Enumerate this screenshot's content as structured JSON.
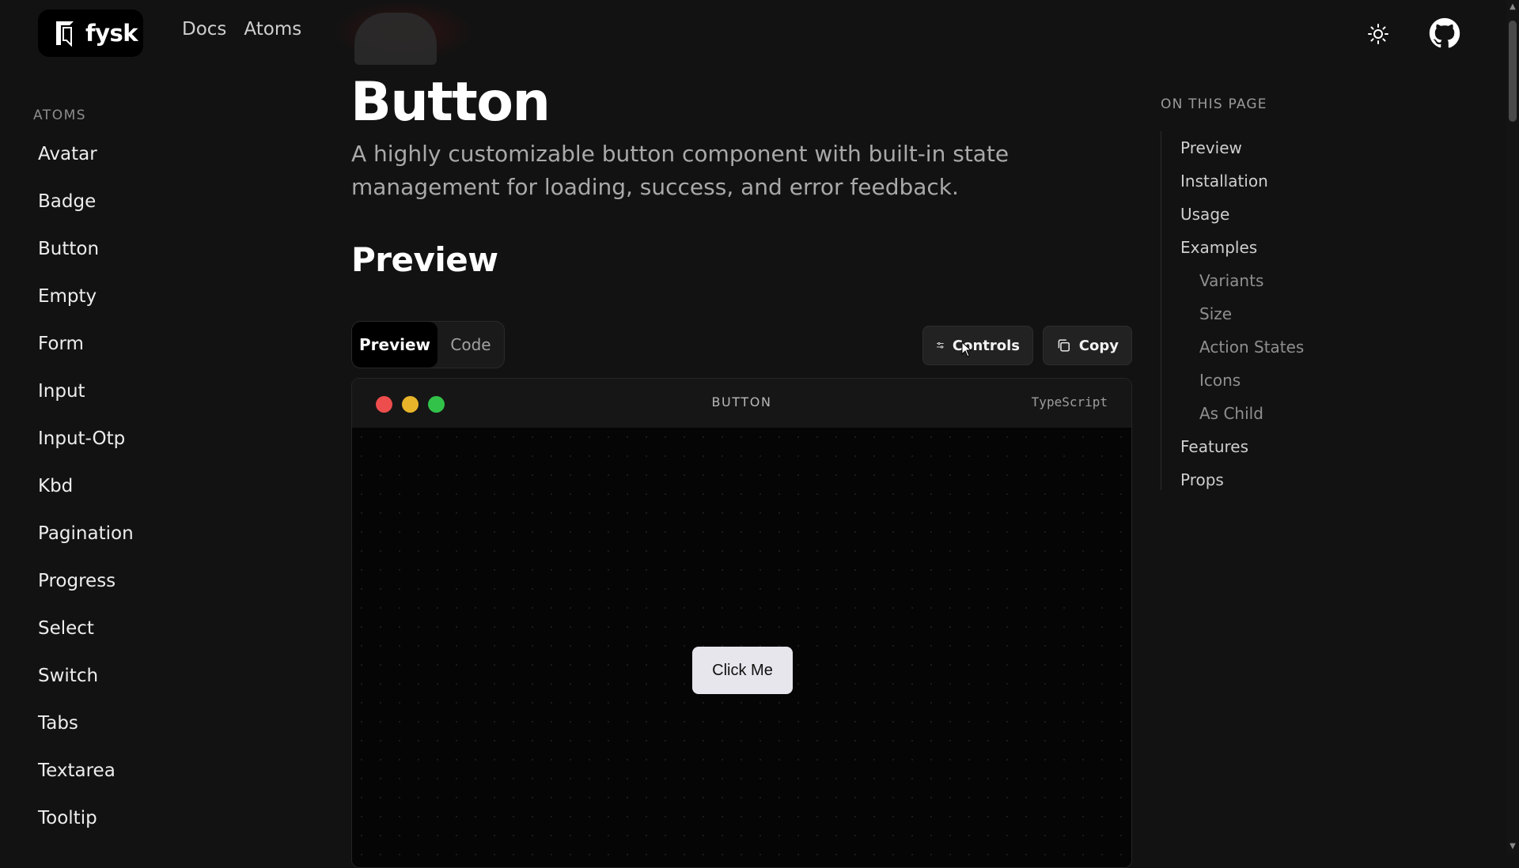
{
  "brand": {
    "name": "fysk"
  },
  "top_nav": {
    "docs": "Docs",
    "atoms": "Atoms"
  },
  "sidebar": {
    "heading": "ATOMS",
    "items": [
      "Avatar",
      "Badge",
      "Button",
      "Empty",
      "Form",
      "Input",
      "Input-Otp",
      "Kbd",
      "Pagination",
      "Progress",
      "Select",
      "Switch",
      "Tabs",
      "Textarea",
      "Tooltip"
    ]
  },
  "main": {
    "title": "Button",
    "description": "A highly customizable button component with built-in state management for loading, success, and error feedback.",
    "section_title": "Preview",
    "tabs": {
      "preview": "Preview",
      "code": "Code"
    },
    "controls_label": "Controls",
    "copy_label": "Copy",
    "frame": {
      "title": "BUTTON",
      "language": "TypeScript"
    },
    "demo_button": "Click Me"
  },
  "toc": {
    "heading": "ON THIS PAGE",
    "items": [
      {
        "label": "Preview",
        "level": 1
      },
      {
        "label": "Installation",
        "level": 1
      },
      {
        "label": "Usage",
        "level": 1
      },
      {
        "label": "Examples",
        "level": 1
      },
      {
        "label": "Variants",
        "level": 2
      },
      {
        "label": "Size",
        "level": 2
      },
      {
        "label": "Action States",
        "level": 2
      },
      {
        "label": "Icons",
        "level": 2
      },
      {
        "label": "As Child",
        "level": 2
      },
      {
        "label": "Features",
        "level": 1
      },
      {
        "label": "Props",
        "level": 1
      }
    ]
  },
  "icons": {
    "theme": "sun-icon",
    "repo": "github-icon",
    "controls": "sliders-icon",
    "copy": "copy-icon"
  },
  "colors": {
    "background": "#121212",
    "window_red": "#ee4d4d",
    "window_yellow": "#e8b52a",
    "window_green": "#32c24a",
    "demo_button_bg": "#e6e6ec"
  }
}
